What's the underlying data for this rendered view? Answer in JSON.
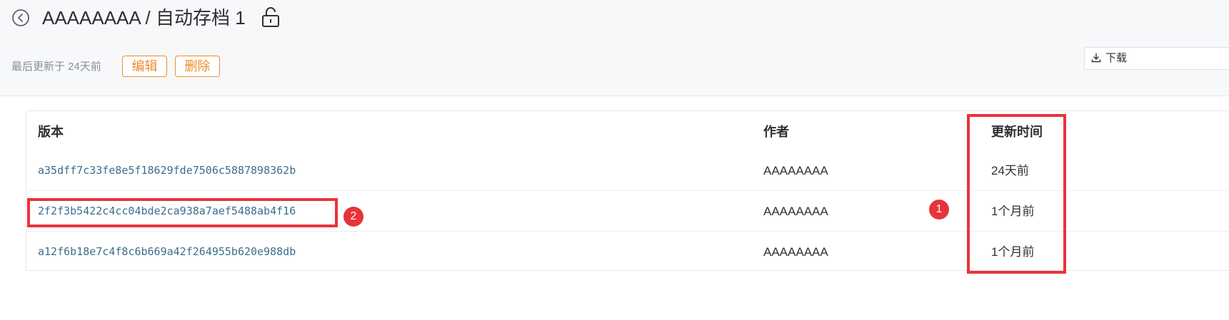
{
  "header": {
    "title": "AAAAAAAA / 自动存档 1",
    "updated_text": "最后更新于 24天前",
    "edit_label": "编辑",
    "delete_label": "删除",
    "download_label": "下载"
  },
  "table": {
    "columns": [
      "版本",
      "作者",
      "更新时间"
    ],
    "rows": [
      {
        "version": "a35dff7c33fe8e5f18629fde7506c5887898362b",
        "author": "AAAAAAAA",
        "time": "24天前"
      },
      {
        "version": "2f2f3b5422c4cc04bde2ca938a7aef5488ab4f16",
        "author": "AAAAAAAA",
        "time": "1个月前"
      },
      {
        "version": "a12f6b18e7c4f8c6b669a42f264955b620e988db",
        "author": "AAAAAAAA",
        "time": "1个月前"
      }
    ]
  },
  "annotations": {
    "badge_1": "1",
    "badge_2": "2"
  },
  "colors": {
    "accent_orange": "#f08c2e",
    "highlight_red": "#e8333a",
    "hash_link": "#3c6e8c"
  },
  "icons": [
    "back-icon",
    "lock-icon",
    "download-icon"
  ]
}
